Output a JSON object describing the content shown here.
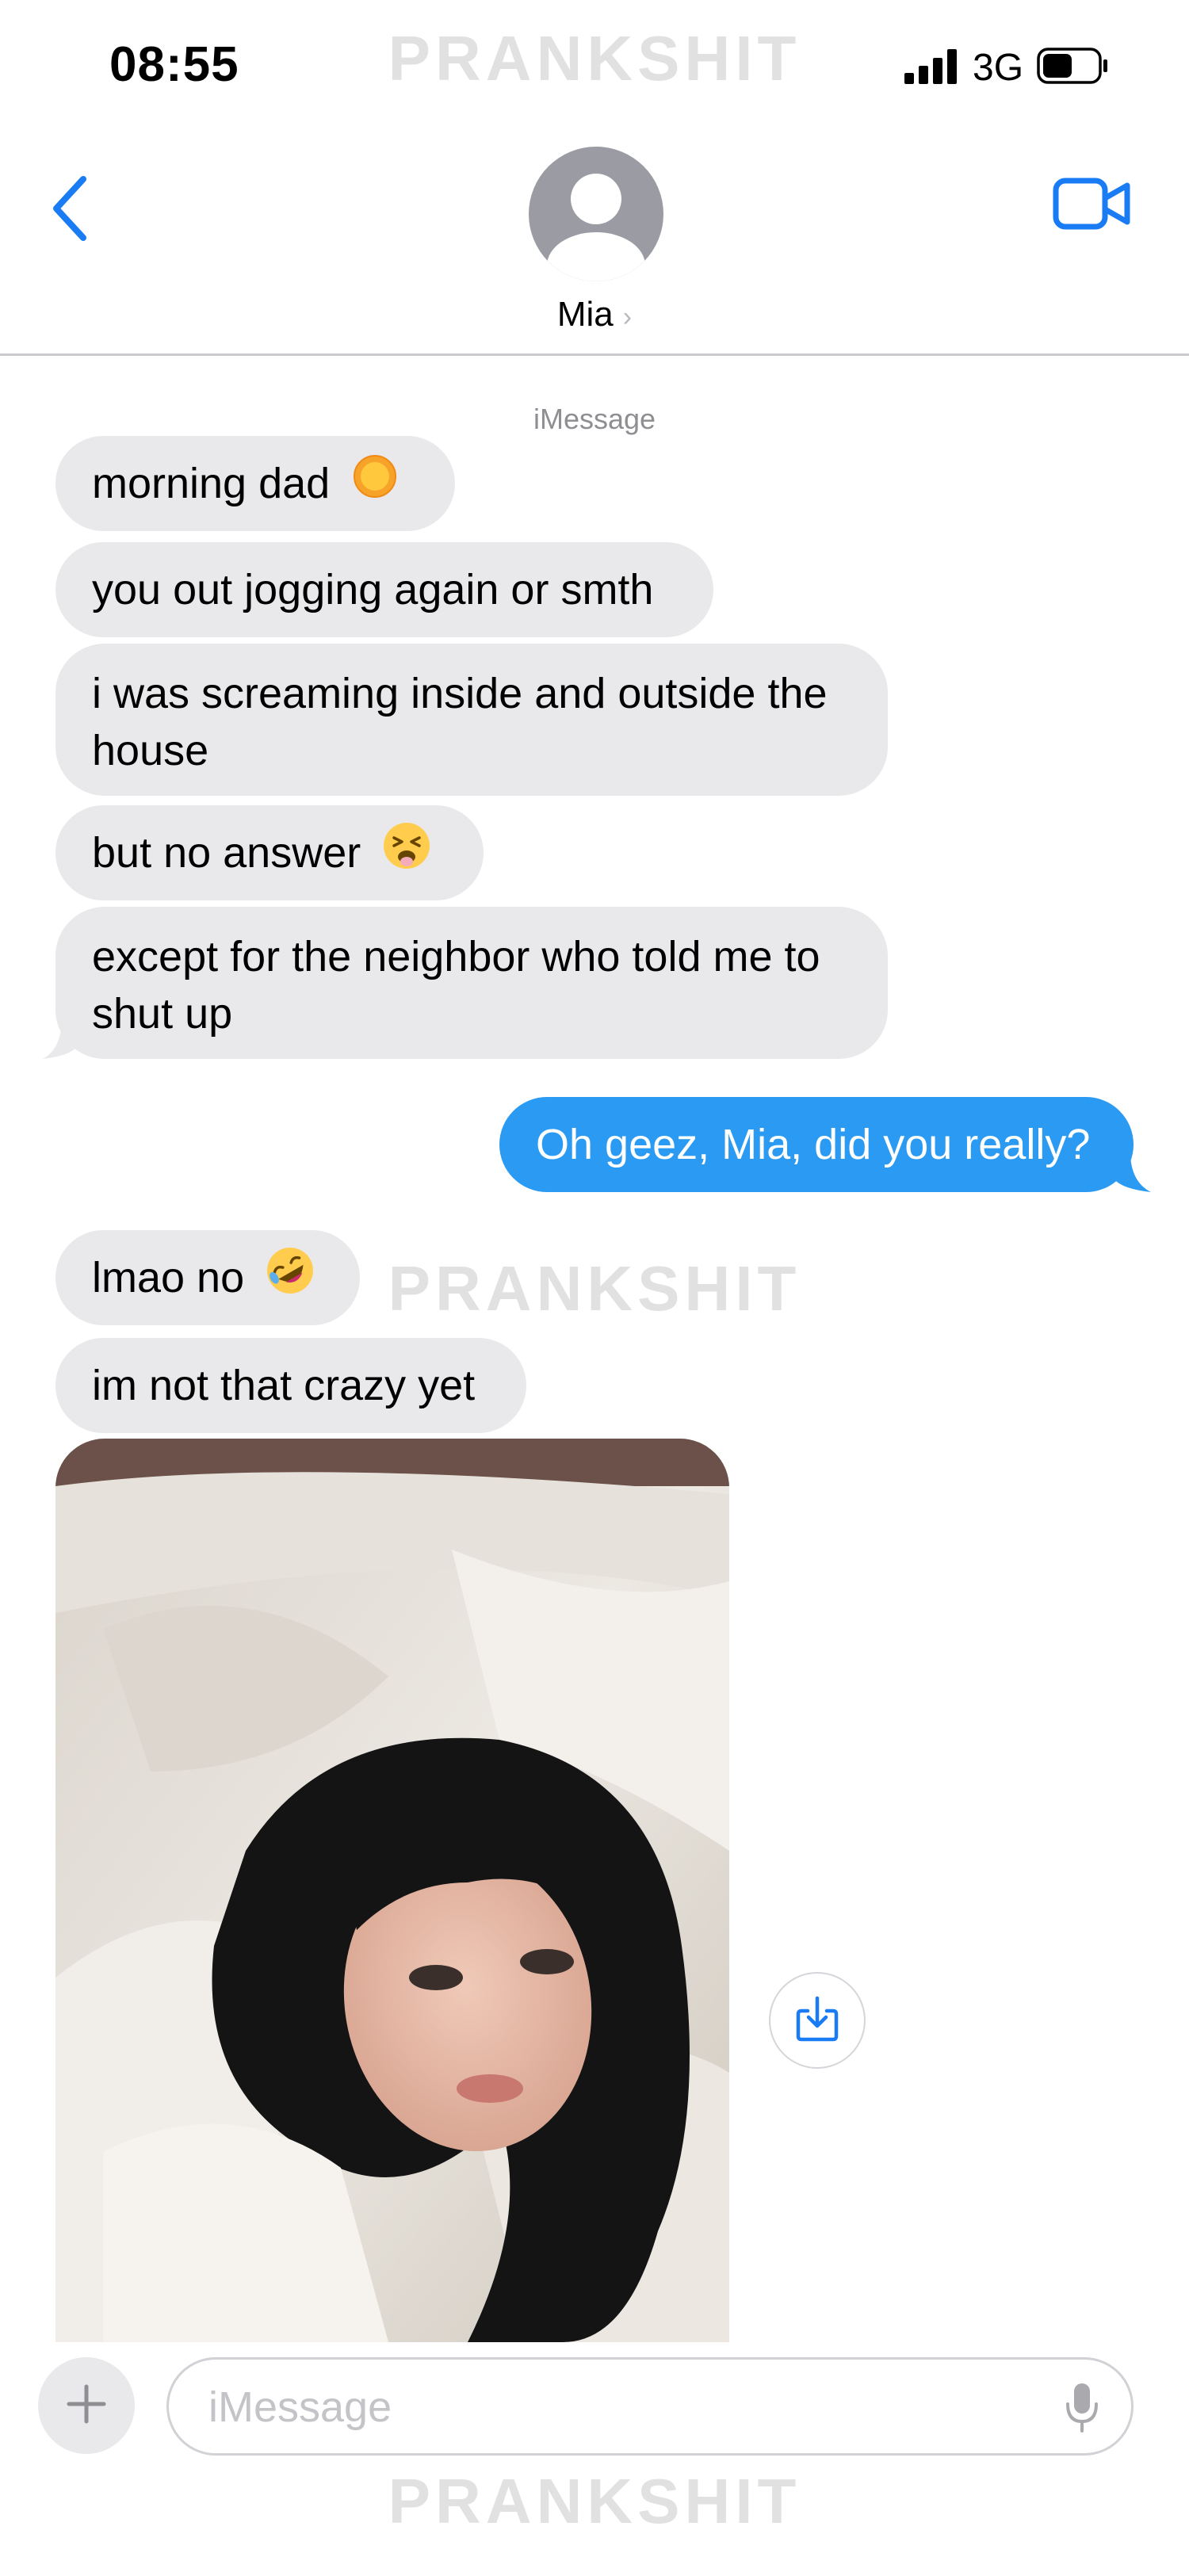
{
  "status_bar": {
    "time": "08:55",
    "network": "3G",
    "signal_bars": 4,
    "battery_level": 0.55
  },
  "watermark": "PRANKSHIT",
  "header": {
    "contact_name": "Mia",
    "chevron": "›",
    "back_icon": "chevron-left-icon",
    "video_icon": "video-camera-icon",
    "avatar_icon": "person-silhouette-icon"
  },
  "conversation": {
    "service_label": "iMessage",
    "messages": [
      {
        "direction": "incoming",
        "text": "morning dad",
        "emoji": "sun-emoji"
      },
      {
        "direction": "incoming",
        "text": "you out jogging again or smth"
      },
      {
        "direction": "incoming",
        "text": "i was screaming inside and outside the house"
      },
      {
        "direction": "incoming",
        "text": "but no answer",
        "emoji": "tired-face-emoji"
      },
      {
        "direction": "incoming",
        "text": "except for the neighbor who told me to shut up"
      },
      {
        "direction": "outgoing",
        "text": "Oh geez, Mia, did you really?"
      },
      {
        "direction": "incoming",
        "text": "lmao no",
        "emoji": "rolling-on-floor-laughing-emoji"
      },
      {
        "direction": "incoming",
        "text": "im not that crazy yet"
      },
      {
        "direction": "incoming",
        "type": "photo",
        "photo_icon": "selfie-photo"
      }
    ]
  },
  "composer": {
    "placeholder": "iMessage",
    "value": "",
    "plus_icon": "plus-icon",
    "mic_icon": "microphone-icon",
    "save_icon": "save-download-icon"
  },
  "colors": {
    "accent": "#1a7cf4",
    "outgoing_bubble": "#2a9af3",
    "incoming_bubble": "#e9e9eb",
    "avatar": "#9a9ba3"
  }
}
